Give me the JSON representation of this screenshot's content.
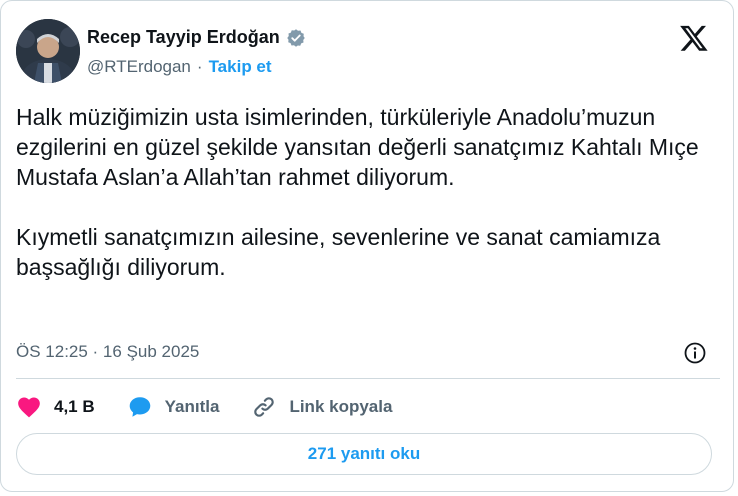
{
  "author": {
    "name": "Recep Tayyip Erdoğan",
    "handle": "@RTErdogan",
    "separator": "·",
    "follow_label": "Takip et"
  },
  "tweet": {
    "paragraphs": [
      "Halk müziğimizin usta isimlerinden, türküleriyle Anadolu’muzun ezgilerini en güzel şekilde yansıtan değerli sanatçımız Kahtalı Mıçe Mustafa Aslan’a Allah’tan rahmet diliyorum.",
      "Kıymetli sanatçımızın ailesine, sevenlerine ve sanat camiamıza başsağlığı diliyorum."
    ],
    "timestamp": "ÖS 12:25 · 16 Şub 2025"
  },
  "actions": {
    "likes": "4,1 B",
    "reply_label": "Yanıtla",
    "copy_link_label": "Link kopyala"
  },
  "footer": {
    "read_replies_label": "271 yanıtı oku"
  },
  "colors": {
    "accent": "#1d9bf0",
    "like": "#f91880",
    "text": "#0f1419",
    "secondary": "#536471",
    "border": "#cfd9de"
  },
  "icons": [
    "verified-badge-icon",
    "x-logo-icon",
    "info-icon",
    "heart-icon",
    "reply-bubble-icon",
    "link-icon"
  ]
}
